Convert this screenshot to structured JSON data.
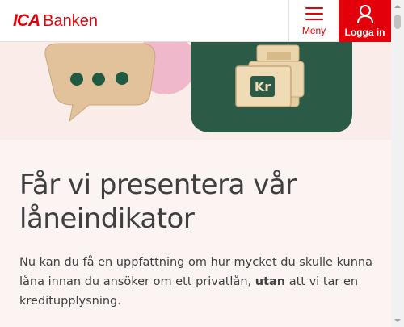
{
  "header": {
    "logo_ica": "ICA",
    "logo_bank": "Banken",
    "menu_label": "Meny",
    "login_label": "Logga in"
  },
  "hero": {
    "coin_text": "Kr"
  },
  "main": {
    "title": "Får vi presentera vår låneindikator",
    "intro_before": "Nu kan du få en uppfattning om hur mycket du skulle kunna låna innan du ansöker om ett privatlån,",
    "intro_bold": "utan",
    "intro_after": "att vi tar en kreditupplysning."
  },
  "colors": {
    "brand_red": "#e3000b",
    "hero_bg": "#faece8",
    "content_bg": "#fbf4f2",
    "card_green": "#2b5a47"
  },
  "icons": [
    "hamburger-menu-icon",
    "user-icon",
    "chat-bubble-illustration",
    "money-bills-illustration"
  ]
}
